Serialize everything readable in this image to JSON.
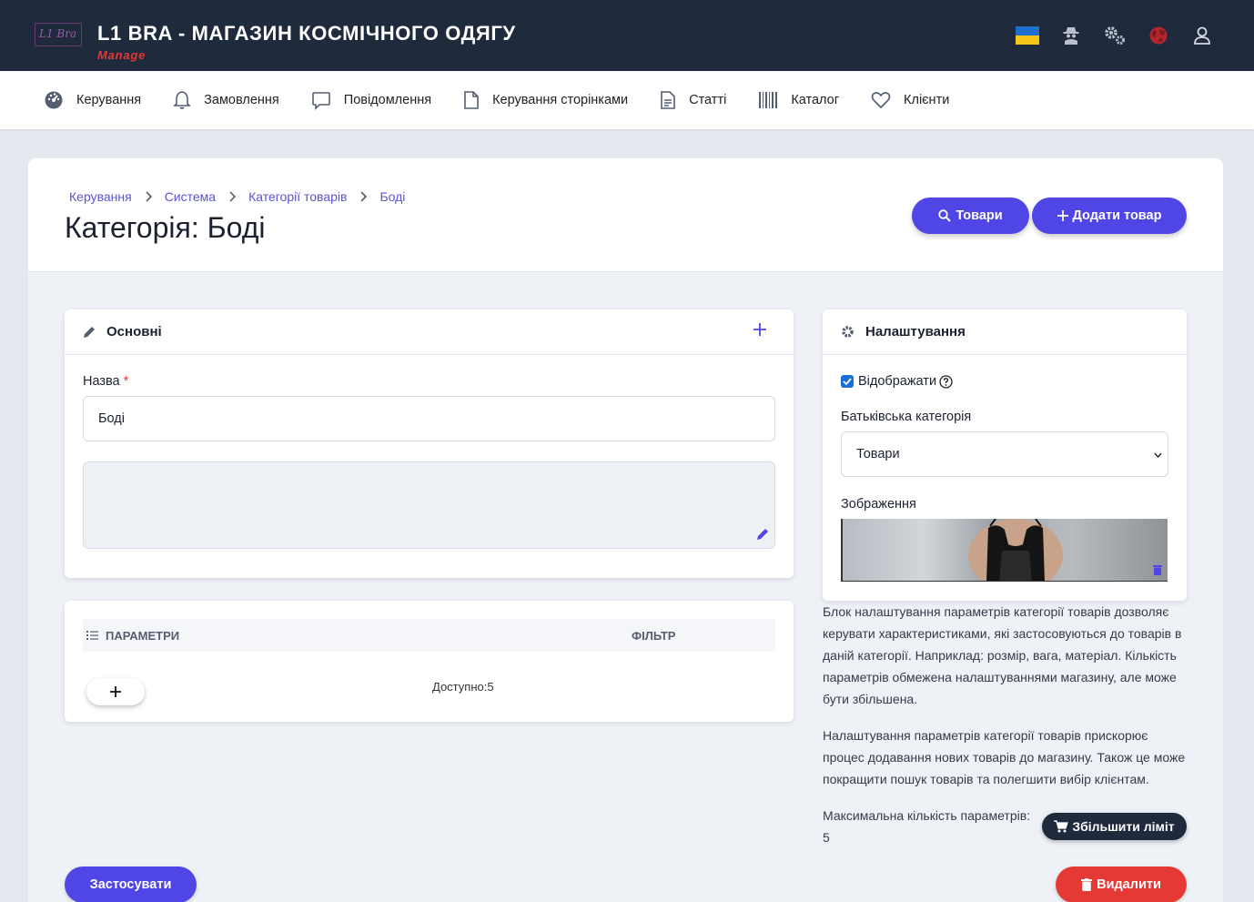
{
  "header": {
    "logo_text": "L1 Bra",
    "title": "L1 BRA - МАГАЗИН КОСМІЧНОГО ОДЯГУ",
    "subtitle": "Manage",
    "icons": [
      "ukraine-flag",
      "spy-icon",
      "gears-icon",
      "globe-icon",
      "user-icon"
    ]
  },
  "nav": {
    "items": [
      {
        "label": "Керування",
        "icon": "dashboard-icon"
      },
      {
        "label": "Замовлення",
        "icon": "bell-icon"
      },
      {
        "label": "Повідомлення",
        "icon": "message-icon"
      },
      {
        "label": "Керування сторінками",
        "icon": "page-icon"
      },
      {
        "label": "Статті",
        "icon": "document-icon"
      },
      {
        "label": "Каталог",
        "icon": "barcode-icon"
      },
      {
        "label": "Клієнти",
        "icon": "heart-icon"
      }
    ]
  },
  "breadcrumb": [
    "Керування",
    "Система",
    "Категорії товарів",
    "Боді"
  ],
  "page_title": "Категорія: Боді",
  "actions": {
    "products_label": "Товари",
    "add_product_label": "Додати товар"
  },
  "basic_panel": {
    "title": "Основні",
    "name_label": "Назва",
    "required_mark": "*",
    "name_value": "Боді"
  },
  "params_panel": {
    "col_params": "ПАРАМЕТРИ",
    "col_filter": "ФІЛЬТР",
    "available_text": "Доступно:5"
  },
  "settings_panel": {
    "title": "Налаштування",
    "display_label": "Відображати",
    "display_checked": true,
    "parent_label": "Батьківська категорія",
    "parent_value": "Товари",
    "image_label": "Зображення"
  },
  "info": {
    "paragraph1": "Блок налаштування параметрів категорії товарів дозволяє керувати характеристиками, які застосовуються до товарів в даній категорії. Наприклад: розмір, вага, матеріал. Кількість параметрів обмежена налаштуваннями магазину, але може бути збільшена.",
    "paragraph2": "Налаштування параметрів категорії товарів прискорює процес додавання нових товарів до магазину. Також це може покращити пошук товарів та полегшити вибір клієнтам.",
    "max_label": "Максимальна кількість параметрів:",
    "max_value": "5",
    "increase_label": "Збільшити ліміт"
  },
  "footer": {
    "apply_label": "Застосувати",
    "delete_label": "Видалити"
  },
  "colors": {
    "header_bg": "#1f2a3d",
    "accent": "#4f46e5",
    "danger": "#e53935"
  }
}
